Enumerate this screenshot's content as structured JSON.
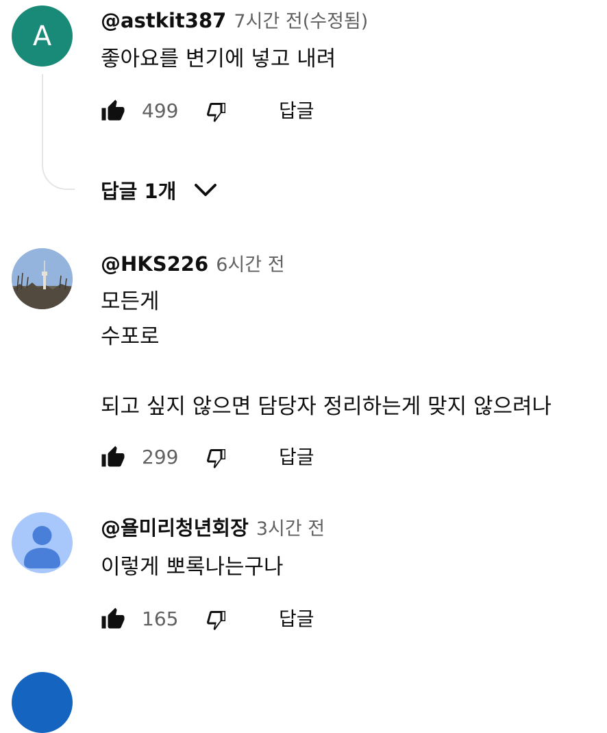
{
  "comments": [
    {
      "avatar_letter": "A",
      "handle": "@astkit387",
      "time": "7시간 전(수정됨)",
      "text": "좋아요를 변기에 넣고 내려",
      "likes": "499",
      "reply_label": "답글",
      "replies_toggle": "답글 1개"
    },
    {
      "handle": "@HKS226",
      "time": "6시간 전",
      "text": "모든게\n수포로\n\n되고 싶지 않으면 담당자 정리하는게 맞지 않으려나",
      "likes": "299",
      "reply_label": "답글"
    },
    {
      "handle": "@욜미리청년회장",
      "time": "3시간 전",
      "text": "이렇게 뽀록나는구나",
      "likes": "165",
      "reply_label": "답글"
    }
  ],
  "colors": {
    "avatar_a": "#1a8a78",
    "avatar_default": "#a8c7fa",
    "avatar_default_figure": "#4a7fd9",
    "secondary_text": "#606060"
  }
}
